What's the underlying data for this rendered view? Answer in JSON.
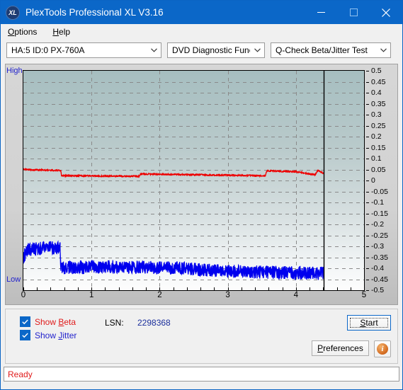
{
  "window": {
    "title": "PlexTools Professional XL V3.16",
    "app_icon": "XL",
    "minimize_icon": "minimize-icon",
    "maximize_icon": "maximize-icon",
    "close_icon": "close-icon"
  },
  "menu": {
    "items": [
      {
        "label": "Options",
        "accel": "O"
      },
      {
        "label": "Help",
        "accel": "H"
      }
    ]
  },
  "toolbar": {
    "drive_combo": {
      "value": "HA:5 ID:0  PX-760A"
    },
    "function_combo": {
      "value": "DVD Diagnostic Functions"
    },
    "test_combo": {
      "value": "Q-Check Beta/Jitter Test"
    },
    "dropdown_icon": "chevron-down-icon"
  },
  "controls": {
    "show_beta": {
      "label": "Show Beta",
      "accel": "B",
      "checked": true,
      "color": "#e01b1b"
    },
    "show_jitter": {
      "label": "Show Jitter",
      "accel": "J",
      "checked": true,
      "color": "#2222cc"
    },
    "lsn_label": "LSN:",
    "lsn_value": "2298368",
    "start_button": {
      "label": "Start",
      "accel": "S"
    },
    "preferences_button": {
      "label": "Preferences",
      "accel": "P"
    },
    "info_button": {
      "label": "i",
      "icon": "info-icon"
    }
  },
  "statusbar": {
    "text": "Ready",
    "color": "#e01b1b"
  },
  "chart_data": {
    "type": "line",
    "title": "Q-Check Beta/Jitter Test",
    "xlabel": "",
    "ylabel": "",
    "xlim": [
      0,
      5
    ],
    "ylim": [
      -0.5,
      0.5
    ],
    "xticks": [
      0,
      1,
      2,
      3,
      4,
      5
    ],
    "yticks": [
      0.5,
      0.45,
      0.4,
      0.35,
      0.3,
      0.25,
      0.2,
      0.15,
      0.1,
      0.05,
      0,
      -0.05,
      -0.1,
      -0.15,
      -0.2,
      -0.25,
      -0.3,
      -0.35,
      -0.4,
      -0.45,
      -0.5
    ],
    "ytick_labels": [
      "0.5",
      "0.45",
      "0.4",
      "0.35",
      "0.3",
      "0.25",
      "0.2",
      "0.15",
      "0.1",
      "0.05",
      "0",
      "-0.05",
      "-0.1",
      "-0.15",
      "-0.2",
      "-0.25",
      "-0.3",
      "-0.35",
      "-0.4",
      "-0.45",
      "-0.5"
    ],
    "axis_top_label": "High",
    "axis_bottom_label": "Low",
    "grid": true,
    "cursor_x": 4.41,
    "data_end_x": 4.41,
    "legend_position": "below-plot",
    "series": [
      {
        "name": "Beta",
        "color": "#ee0000",
        "noise": 0.004,
        "segments": [
          {
            "x0": 0.0,
            "x1": 0.1,
            "y0": 0.052,
            "y1": 0.049
          },
          {
            "x0": 0.1,
            "x1": 0.5,
            "y0": 0.049,
            "y1": 0.046
          },
          {
            "x0": 0.5,
            "x1": 0.55,
            "y0": 0.046,
            "y1": 0.044
          },
          {
            "x0": 0.55,
            "x1": 0.56,
            "y0": 0.044,
            "y1": 0.022
          },
          {
            "x0": 0.56,
            "x1": 1.7,
            "y0": 0.022,
            "y1": 0.019
          },
          {
            "x0": 1.7,
            "x1": 1.72,
            "y0": 0.019,
            "y1": 0.03
          },
          {
            "x0": 1.72,
            "x1": 3.0,
            "y0": 0.03,
            "y1": 0.024
          },
          {
            "x0": 3.0,
            "x1": 3.55,
            "y0": 0.024,
            "y1": 0.021
          },
          {
            "x0": 3.55,
            "x1": 3.57,
            "y0": 0.021,
            "y1": 0.044
          },
          {
            "x0": 3.57,
            "x1": 4.0,
            "y0": 0.044,
            "y1": 0.04
          },
          {
            "x0": 4.0,
            "x1": 4.28,
            "y0": 0.04,
            "y1": 0.026
          },
          {
            "x0": 4.28,
            "x1": 4.32,
            "y0": 0.026,
            "y1": 0.046
          },
          {
            "x0": 4.32,
            "x1": 4.41,
            "y0": 0.046,
            "y1": 0.032
          }
        ]
      },
      {
        "name": "Jitter",
        "color": "#0000ee",
        "noise": 0.03,
        "segments": [
          {
            "x0": 0.0,
            "x1": 0.06,
            "y0": -0.35,
            "y1": -0.318
          },
          {
            "x0": 0.06,
            "x1": 0.25,
            "y0": -0.318,
            "y1": -0.308
          },
          {
            "x0": 0.25,
            "x1": 0.54,
            "y0": -0.308,
            "y1": -0.306
          },
          {
            "x0": 0.54,
            "x1": 0.55,
            "y0": -0.306,
            "y1": -0.398
          },
          {
            "x0": 0.55,
            "x1": 1.2,
            "y0": -0.398,
            "y1": -0.392
          },
          {
            "x0": 1.2,
            "x1": 2.3,
            "y0": -0.392,
            "y1": -0.4
          },
          {
            "x0": 2.3,
            "x1": 3.0,
            "y0": -0.4,
            "y1": -0.414
          },
          {
            "x0": 3.0,
            "x1": 3.8,
            "y0": -0.414,
            "y1": -0.42
          },
          {
            "x0": 3.8,
            "x1": 4.41,
            "y0": -0.42,
            "y1": -0.424
          }
        ]
      }
    ]
  }
}
